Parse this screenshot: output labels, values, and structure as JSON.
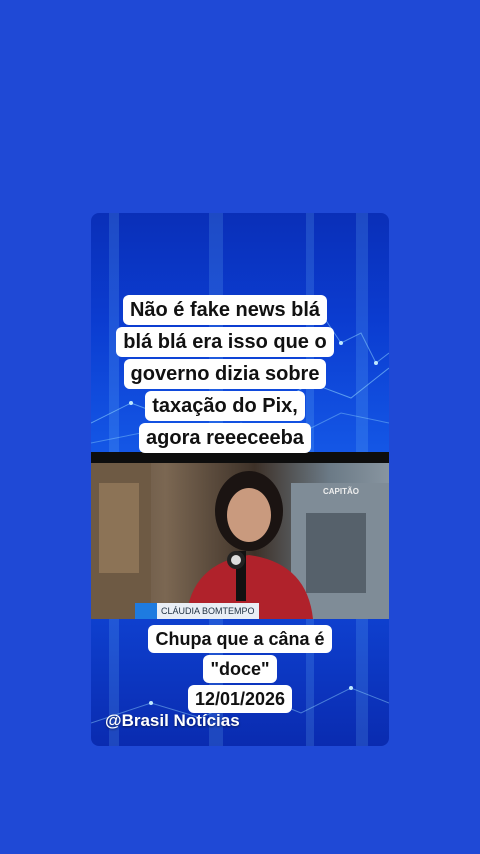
{
  "caption_top": {
    "lines": [
      "Não é fake news blá",
      "blá blá era isso que o",
      "governo dizia sobre",
      "taxação do Pix,",
      "agora reeeceeba"
    ]
  },
  "video": {
    "reporter_name": "CLÁUDIA BOMTEMPO",
    "logo_text": "CAPITÃO"
  },
  "caption_bottom": {
    "lines": [
      "Chupa que a câna é",
      "\"doce\"",
      "12/01/2026"
    ]
  },
  "handle": "@Brasil Notícias"
}
